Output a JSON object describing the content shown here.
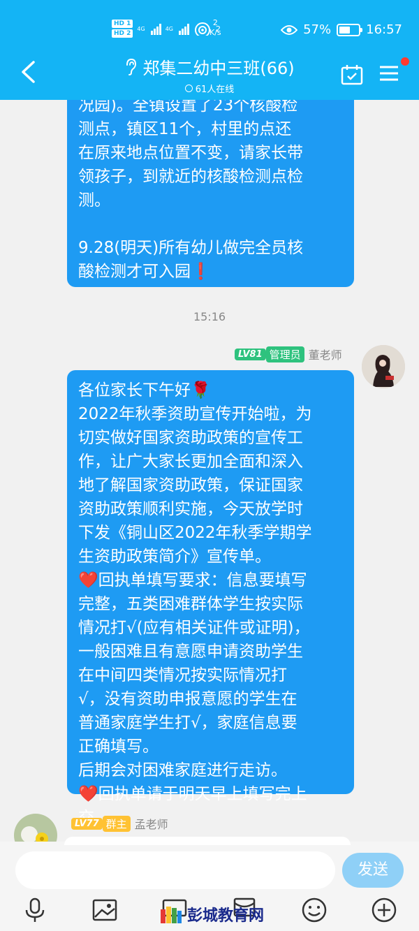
{
  "status_bar": {
    "hd1": "HD 1",
    "hd2": "HD 2",
    "net1": "4G",
    "net2": "4G",
    "wifi_level": "2",
    "speed_value": "2",
    "speed_unit": "K/s",
    "battery": "57%",
    "battery_level": 0.57,
    "time": "16:57"
  },
  "chat": {
    "title": "郑集二幼中三班(66)",
    "online": "61人在线",
    "back_icon": "back-arrow-icon",
    "accent": "#14b4f5",
    "bubble_color": "#1e9bf3"
  },
  "messages": [
    {
      "lines": [
        "况园)。全镇设置了23个核酸检",
        "测点，镇区11个，村里的点还",
        "在原来地点位置不变，请家长带",
        "领孩子，到就近的核酸检测点检",
        "测。",
        "",
        "9.28(明天)所有幼儿做完全员核",
        "酸检测才可入园❗"
      ]
    },
    {
      "time": "15:16",
      "sender": {
        "level": "LV81",
        "role": "管理员",
        "name": "董老师"
      },
      "lines": [
        "各位家长下午好🌹",
        "2022年秋季资助宣传开始啦，为",
        "切实做好国家资助政策的宣传工",
        "作，让广大家长更加全面和深入",
        "地了解国家资助政策，保证国家",
        "资助政策顺利实施，今天放学时",
        "下发《铜山区2022年秋季学期学",
        "生资助政策简介》宣传单。",
        "❤️回执单填写要求：信息要填写",
        "完整，五类困难群体学生按实际",
        "情况打√(应有相关证件或证明)，",
        "一般困难且有意愿申请资助学生",
        "在中间四类情况按实际情况打",
        "√，没有资助申报意愿的学生在",
        "普通家庭学生打√，家庭信息要",
        "正确填写。",
        "后期会对困难家庭进行走访。",
        "❤️回执单请于明天早上填写完上",
        "交。"
      ]
    },
    {
      "sender": {
        "level": "LV77",
        "role": "群主",
        "name": "孟老师"
      }
    }
  ],
  "input": {
    "placeholder": "",
    "send_label": "发送"
  },
  "toolbar": [
    "mic-icon",
    "image-icon",
    "camera-icon",
    "red-packet-icon",
    "emoji-icon",
    "plus-icon"
  ],
  "watermark": "彭城教育网"
}
